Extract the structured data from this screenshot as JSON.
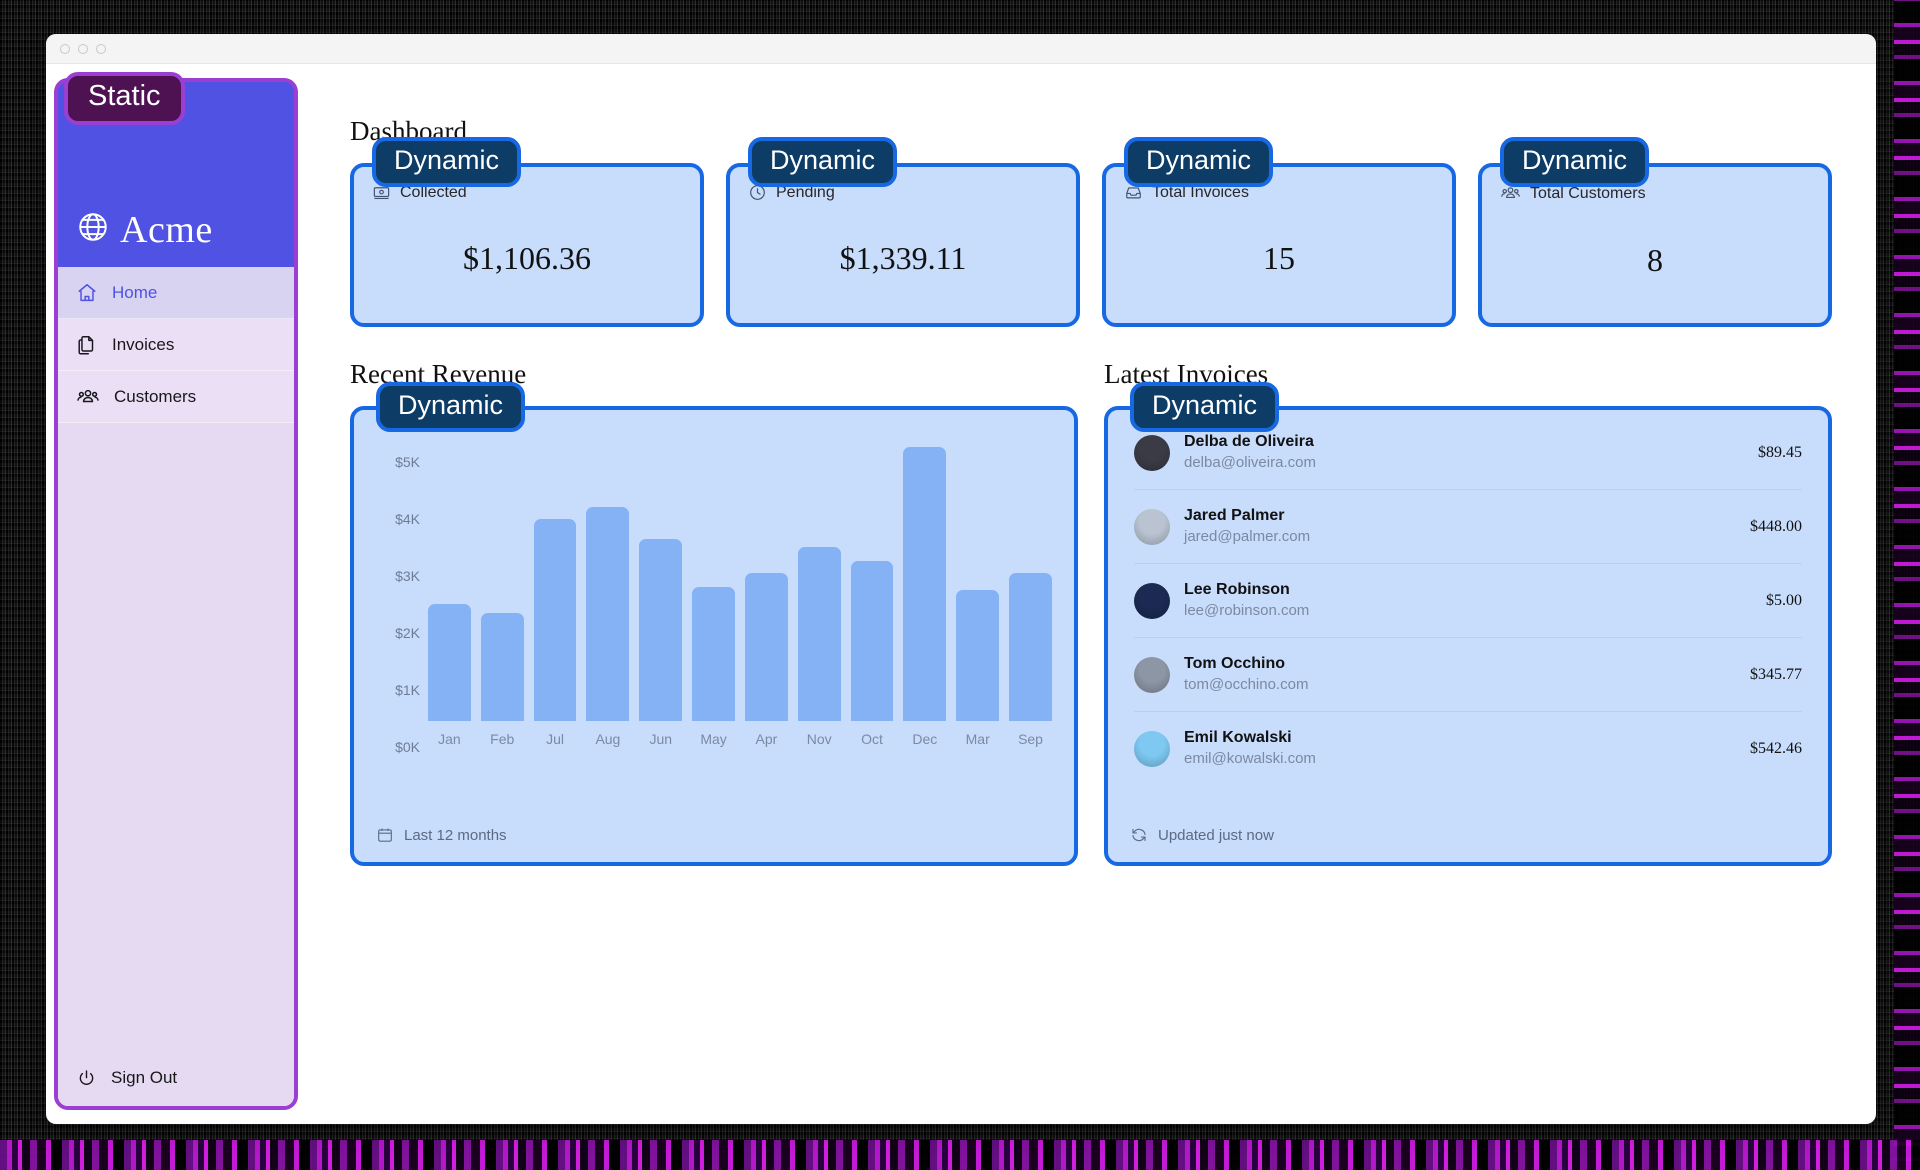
{
  "window": {
    "dots": [
      "close",
      "minimize",
      "zoom"
    ]
  },
  "overlays": {
    "static_label": "Static",
    "dynamic_label": "Dynamic"
  },
  "sidebar": {
    "brand": "Acme",
    "brand_icon": "globe-icon",
    "items": [
      {
        "label": "Home",
        "icon": "home-icon",
        "active": true
      },
      {
        "label": "Invoices",
        "icon": "documents-icon",
        "active": false
      },
      {
        "label": "Customers",
        "icon": "users-icon",
        "active": false
      }
    ],
    "signout": {
      "label": "Sign Out",
      "icon": "power-icon"
    }
  },
  "main": {
    "dashboard_title": "Dashboard",
    "cards": [
      {
        "label": "Collected",
        "value": "$1,106.36",
        "icon": "banknote-icon"
      },
      {
        "label": "Pending",
        "value": "$1,339.11",
        "icon": "clock-icon"
      },
      {
        "label": "Total Invoices",
        "value": "15",
        "icon": "inbox-icon"
      },
      {
        "label": "Total Customers",
        "value": "8",
        "icon": "users-icon"
      }
    ],
    "revenue_title": "Recent Revenue",
    "invoices_title": "Latest Invoices",
    "chart_footer": {
      "label": "Last 12 months",
      "icon": "calendar-icon"
    },
    "invoices_footer": {
      "label": "Updated just now",
      "icon": "refresh-icon"
    },
    "invoices": [
      {
        "name": "Delba de Oliveira",
        "email": "delba@oliveira.com",
        "amount": "$89.45",
        "avatar_color": "#3b3b46"
      },
      {
        "name": "Jared Palmer",
        "email": "jared@palmer.com",
        "amount": "$448.00",
        "avatar_color": "#b9c3d2"
      },
      {
        "name": "Lee Robinson",
        "email": "lee@robinson.com",
        "amount": "$5.00",
        "avatar_color": "#1b2a52"
      },
      {
        "name": "Tom Occhino",
        "email": "tom@occhino.com",
        "amount": "$345.77",
        "avatar_color": "#8d96a5"
      },
      {
        "name": "Emil Kowalski",
        "email": "emil@kowalski.com",
        "amount": "$542.46",
        "avatar_color": "#7ec8f2"
      }
    ]
  },
  "chart_data": {
    "type": "bar",
    "title": "Recent Revenue",
    "xlabel": "",
    "ylabel": "",
    "ylim": [
      0,
      5000
    ],
    "yticks": [
      0,
      1000,
      2000,
      3000,
      4000,
      5000
    ],
    "ytick_labels": [
      "$0K",
      "$1K",
      "$2K",
      "$3K",
      "$4K",
      "$5K"
    ],
    "categories": [
      "Jan",
      "Feb",
      "Jul",
      "Aug",
      "Jun",
      "May",
      "Apr",
      "Nov",
      "Oct",
      "Dec",
      "Mar",
      "Sep"
    ],
    "values": [
      2050,
      1900,
      3550,
      3750,
      3200,
      2350,
      2600,
      3050,
      2800,
      4800,
      2300,
      2600
    ],
    "grid": false,
    "legend": "none",
    "bar_color": "#85b1f5"
  }
}
